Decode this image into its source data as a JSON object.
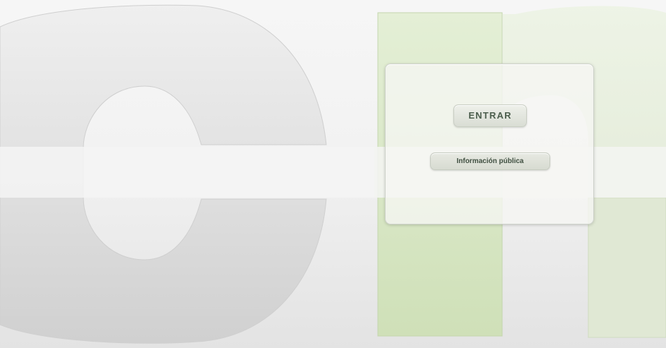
{
  "login": {
    "enter_label": "ENTRAR",
    "public_info_label": "Información pública"
  },
  "colors": {
    "background": "#e7e7e7",
    "logo_gray": "#d8d8d8",
    "logo_green": "#d6e5c2",
    "button_text": "#4c5e4d"
  }
}
